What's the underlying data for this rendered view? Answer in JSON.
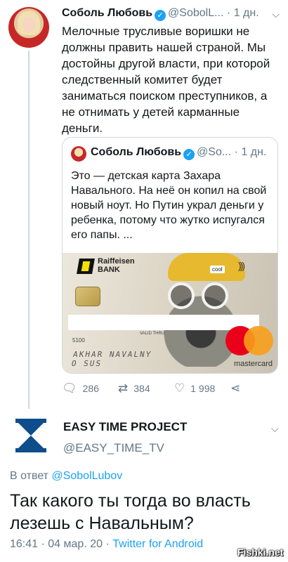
{
  "tweet": {
    "author_name": "Соболь Любовь",
    "handle": "@SobolL...",
    "separator": "·",
    "time": "1 дн.",
    "text": "Мелочные трусливые воришки не должны править нашей страной. Мы достойны другой власти, при которой следственный комитет будет заниматься поиском преступников, а не отнимать у детей карманные деньги.",
    "quote": {
      "author_name": "Соболь Любовь",
      "handle": "@So...",
      "time": "1 дн.",
      "text": "Это — детская карта Захара Навального. На неё он копил на свой новый ноут. Но Путин украл деньги у ребенка, потому что жутко испугался его папы. ...",
      "card": {
        "bank_line1": "Raiffeisen",
        "bank_line2": "BANK",
        "hat_label": "cool",
        "card_prefix": "5100",
        "valid_label": "VALID THRU",
        "holder": "AKHAR NAVALNY",
        "holder_line2": "O SUS",
        "network": "mastercard"
      }
    },
    "actions": {
      "replies": "286",
      "retweets": "384",
      "likes": "1 998"
    }
  },
  "reply": {
    "author_name": "EASY TIME PROJECT",
    "handle": "@EASY_TIME_TV",
    "in_reply_prefix": "В ответ",
    "in_reply_mention": "@SobolLubov",
    "text": "Так какого ты тогда во власть лезешь с Навальным?",
    "time": "16:41",
    "date": "04 мар. 20",
    "separator": "·",
    "source": "Twitter for Android"
  },
  "watermark": "Fishki.net",
  "icons": {
    "reply": "reply-icon",
    "retweet": "retweet-icon",
    "like": "heart-icon",
    "share": "share-icon",
    "verified": "verified-badge-icon",
    "more": "chevron-down-icon"
  },
  "colors": {
    "accent": "#1da1f2",
    "muted": "#657786",
    "text": "#14171a",
    "brand_avatar": "#0d4d8c"
  }
}
